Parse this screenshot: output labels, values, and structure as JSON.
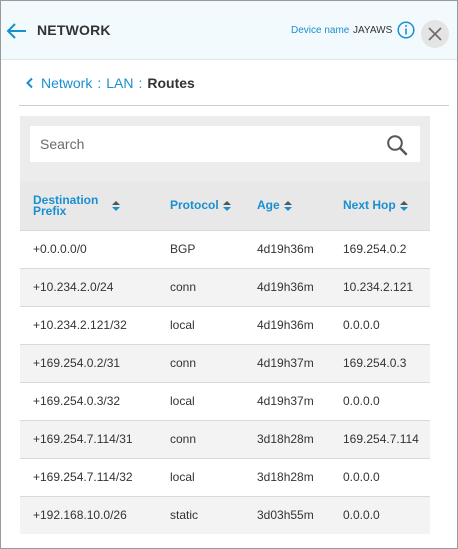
{
  "header": {
    "title": "NETWORK",
    "device_label": "Device name",
    "device_value": "JAYAWS"
  },
  "breadcrumb": {
    "items": [
      "Network",
      "LAN"
    ],
    "separator": ":",
    "current": "Routes"
  },
  "search": {
    "placeholder": "Search",
    "value": ""
  },
  "table": {
    "columns": [
      {
        "label_line1": "Destination",
        "label_line2": "Prefix"
      },
      {
        "label_line1": "Protocol"
      },
      {
        "label_line1": "Age"
      },
      {
        "label_line1": "Next Hop"
      }
    ],
    "rows": [
      {
        "prefix": "+0.0.0.0/0",
        "protocol": "BGP",
        "age": "4d19h36m",
        "next_hop": "169.254.0.2"
      },
      {
        "prefix": "+10.234.2.0/24",
        "protocol": "conn",
        "age": "4d19h36m",
        "next_hop": "10.234.2.121"
      },
      {
        "prefix": "+10.234.2.121/32",
        "protocol": "local",
        "age": "4d19h36m",
        "next_hop": "0.0.0.0"
      },
      {
        "prefix": "+169.254.0.2/31",
        "protocol": "conn",
        "age": "4d19h37m",
        "next_hop": "169.254.0.3"
      },
      {
        "prefix": "+169.254.0.3/32",
        "protocol": "local",
        "age": "4d19h37m",
        "next_hop": "0.0.0.0"
      },
      {
        "prefix": "+169.254.7.114/31",
        "protocol": "conn",
        "age": "3d18h28m",
        "next_hop": "169.254.7.114"
      },
      {
        "prefix": "+169.254.7.114/32",
        "protocol": "local",
        "age": "3d18h28m",
        "next_hop": "0.0.0.0"
      },
      {
        "prefix": "+192.168.10.0/26",
        "protocol": "static",
        "age": "3d03h55m",
        "next_hop": "0.0.0.0"
      }
    ]
  },
  "colors": {
    "accent": "#1a8fd0",
    "header_bg": "#f2fafe",
    "text": "#333333",
    "table_header_bg": "#e8e8e8",
    "row_alt_bg": "#f3f3f3"
  },
  "icons": [
    "back-arrow-icon",
    "info-icon",
    "close-icon",
    "chevron-left-icon",
    "search-icon",
    "sort-icon"
  ]
}
